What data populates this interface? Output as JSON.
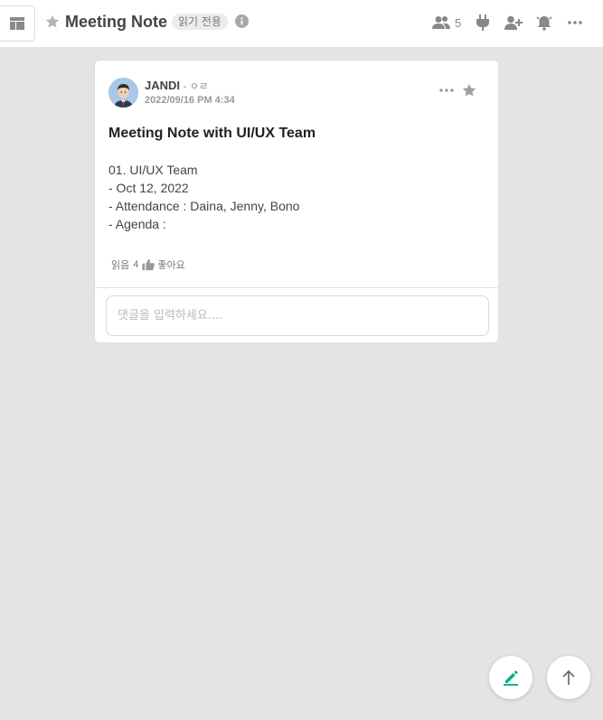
{
  "header": {
    "layout_icon": "layout-panel-icon",
    "favorite_icon": "star-icon",
    "title": "Meeting Note",
    "readonly_badge": "읽기 전용",
    "info_icon": "info-icon",
    "member_count": "5",
    "icons": [
      "members-icon",
      "plug-icon",
      "add-member-icon",
      "notification-bell-icon",
      "more-icon"
    ]
  },
  "post": {
    "author": "JANDI",
    "author_sub": " - ㅇㄹ",
    "timestamp": "2022/09/16 PM 4:34",
    "title": "Meeting Note with UI/UX Team",
    "body": [
      "01. UI/UX Team",
      "- Oct 12, 2022",
      "- Attendance : Daina, Jenny, Bono",
      "- Agenda :"
    ],
    "read_label": "읽음",
    "read_count": "4",
    "like_label": "좋아요"
  },
  "comment": {
    "placeholder": "댓글을 입력하세요...."
  },
  "fabs": [
    "compose-icon",
    "scroll-top-icon"
  ],
  "colors": {
    "accent": "#00b388",
    "background": "#e4e4e4",
    "icon_gray": "#a0a0a0"
  }
}
